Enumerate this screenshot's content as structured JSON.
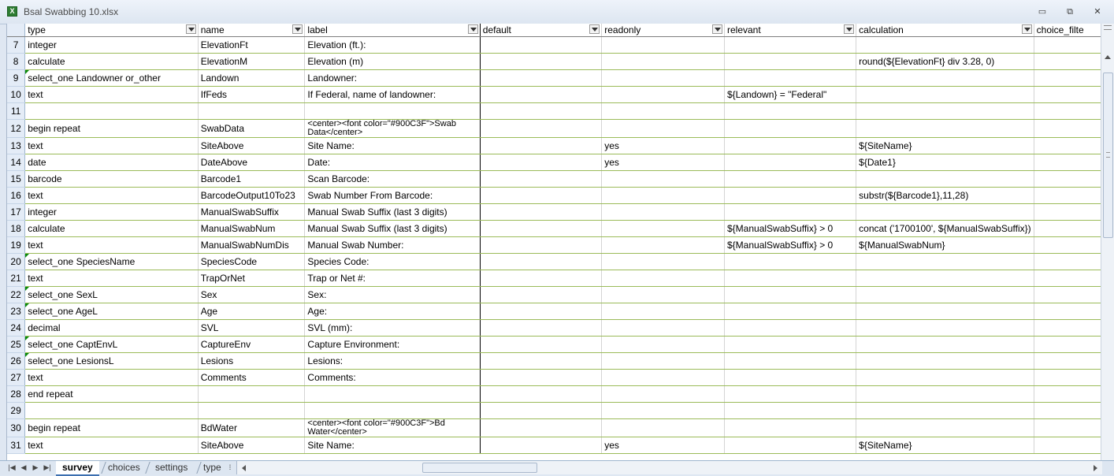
{
  "window": {
    "title": "Bsal Swabbing 10.xlsx",
    "app_icon": "excel-icon",
    "minimize": "▭",
    "restore": "⧉",
    "close": "✕"
  },
  "columns": [
    "type",
    "name",
    "label",
    "default",
    "readonly",
    "relevant",
    "calculation",
    "choice_filte"
  ],
  "rows": [
    {
      "n": "7",
      "type": "integer",
      "name": "ElevationFt",
      "label": "Elevation (ft.):",
      "default": "",
      "readonly": "",
      "relevant": "",
      "calculation": ""
    },
    {
      "n": "8",
      "type": "calculate",
      "name": "ElevationM",
      "label": "Elevation (m)",
      "default": "",
      "readonly": "",
      "relevant": "",
      "calculation": "round(${ElevationFt} div 3.28, 0)"
    },
    {
      "n": "9",
      "type": "select_one Landowner or_other",
      "name": "Landown",
      "label": "Landowner:",
      "default": "",
      "readonly": "",
      "relevant": "",
      "calculation": "",
      "comment": true
    },
    {
      "n": "10",
      "type": "text",
      "name": "IfFeds",
      "label": "If Federal, name of landowner:",
      "default": "",
      "readonly": "",
      "relevant": "${Landown} = \"Federal\"",
      "calculation": ""
    },
    {
      "n": "11",
      "type": "",
      "name": "",
      "label": "",
      "default": "",
      "readonly": "",
      "relevant": "",
      "calculation": ""
    },
    {
      "n": "12",
      "type": "begin repeat",
      "name": "SwabData",
      "label": "<center><font color=\"#900C3F\">Swab Data</center>",
      "default": "",
      "readonly": "",
      "relevant": "",
      "calculation": "",
      "small": true
    },
    {
      "n": "13",
      "type": "text",
      "name": "SiteAbove",
      "label": "Site Name:",
      "default": "",
      "readonly": "yes",
      "relevant": "",
      "calculation": "${SiteName}"
    },
    {
      "n": "14",
      "type": "date",
      "name": "DateAbove",
      "label": "Date:",
      "default": "",
      "readonly": "yes",
      "relevant": "",
      "calculation": "${Date1}"
    },
    {
      "n": "15",
      "type": "barcode",
      "name": "Barcode1",
      "label": "Scan Barcode:",
      "default": "",
      "readonly": "",
      "relevant": "",
      "calculation": ""
    },
    {
      "n": "16",
      "type": "text",
      "name": "BarcodeOutput10To23",
      "label": "Swab Number From Barcode:",
      "default": "",
      "readonly": "",
      "relevant": "",
      "calculation": "substr(${Barcode1},11,28)"
    },
    {
      "n": "17",
      "type": "integer",
      "name": "ManualSwabSuffix",
      "label": "Manual Swab Suffix (last 3 digits)",
      "default": "",
      "readonly": "",
      "relevant": "",
      "calculation": ""
    },
    {
      "n": "18",
      "type": "calculate",
      "name": "ManualSwabNum",
      "label": "Manual Swab Suffix (last 3 digits)",
      "default": "",
      "readonly": "",
      "relevant": "${ManualSwabSuffix} > 0",
      "calculation": "concat ('1700100', ${ManualSwabSuffix})"
    },
    {
      "n": "19",
      "type": "text",
      "name": "ManualSwabNumDis",
      "label": "Manual Swab Number:",
      "default": "",
      "readonly": "",
      "relevant": "${ManualSwabSuffix} > 0",
      "calculation": "${ManualSwabNum}"
    },
    {
      "n": "20",
      "type": "select_one SpeciesName",
      "name": "SpeciesCode",
      "label": "Species Code:",
      "default": "",
      "readonly": "",
      "relevant": "",
      "calculation": "",
      "comment": true
    },
    {
      "n": "21",
      "type": "text",
      "name": "TrapOrNet",
      "label": "Trap or Net #:",
      "default": "",
      "readonly": "",
      "relevant": "",
      "calculation": ""
    },
    {
      "n": "22",
      "type": "select_one SexL",
      "name": "Sex",
      "label": "Sex:",
      "default": "",
      "readonly": "",
      "relevant": "",
      "calculation": "",
      "comment": true
    },
    {
      "n": "23",
      "type": "select_one AgeL",
      "name": "Age",
      "label": "Age:",
      "default": "",
      "readonly": "",
      "relevant": "",
      "calculation": "",
      "comment": true
    },
    {
      "n": "24",
      "type": "decimal",
      "name": "SVL",
      "label": "SVL (mm):",
      "default": "",
      "readonly": "",
      "relevant": "",
      "calculation": ""
    },
    {
      "n": "25",
      "type": "select_one CaptEnvL",
      "name": "CaptureEnv",
      "label": "Capture Environment:",
      "default": "",
      "readonly": "",
      "relevant": "",
      "calculation": "",
      "comment": true
    },
    {
      "n": "26",
      "type": "select_one LesionsL",
      "name": "Lesions",
      "label": "Lesions:",
      "default": "",
      "readonly": "",
      "relevant": "",
      "calculation": "",
      "comment": true
    },
    {
      "n": "27",
      "type": "text",
      "name": "Comments",
      "label": "Comments:",
      "default": "",
      "readonly": "",
      "relevant": "",
      "calculation": ""
    },
    {
      "n": "28",
      "type": "end repeat",
      "name": "",
      "label": "",
      "default": "",
      "readonly": "",
      "relevant": "",
      "calculation": ""
    },
    {
      "n": "29",
      "type": "",
      "name": "",
      "label": "",
      "default": "",
      "readonly": "",
      "relevant": "",
      "calculation": ""
    },
    {
      "n": "30",
      "type": "begin repeat",
      "name": "BdWater",
      "label": "<center><font color=\"#900C3F\">Bd Water</center>",
      "default": "",
      "readonly": "",
      "relevant": "",
      "calculation": "",
      "small": true
    },
    {
      "n": "31",
      "type": "text",
      "name": "SiteAbove",
      "label": "Site Name:",
      "default": "",
      "readonly": "yes",
      "relevant": "",
      "calculation": "${SiteName}"
    }
  ],
  "sheet_tabs": [
    "survey",
    "choices",
    "settings",
    "type"
  ],
  "active_tab": "survey",
  "colors": {
    "row_border": "#9bbb59",
    "header_bg": "#e4ecf7",
    "comment_mark": "#0a8a0a",
    "active_tab_underline": "#3c6fb0"
  }
}
